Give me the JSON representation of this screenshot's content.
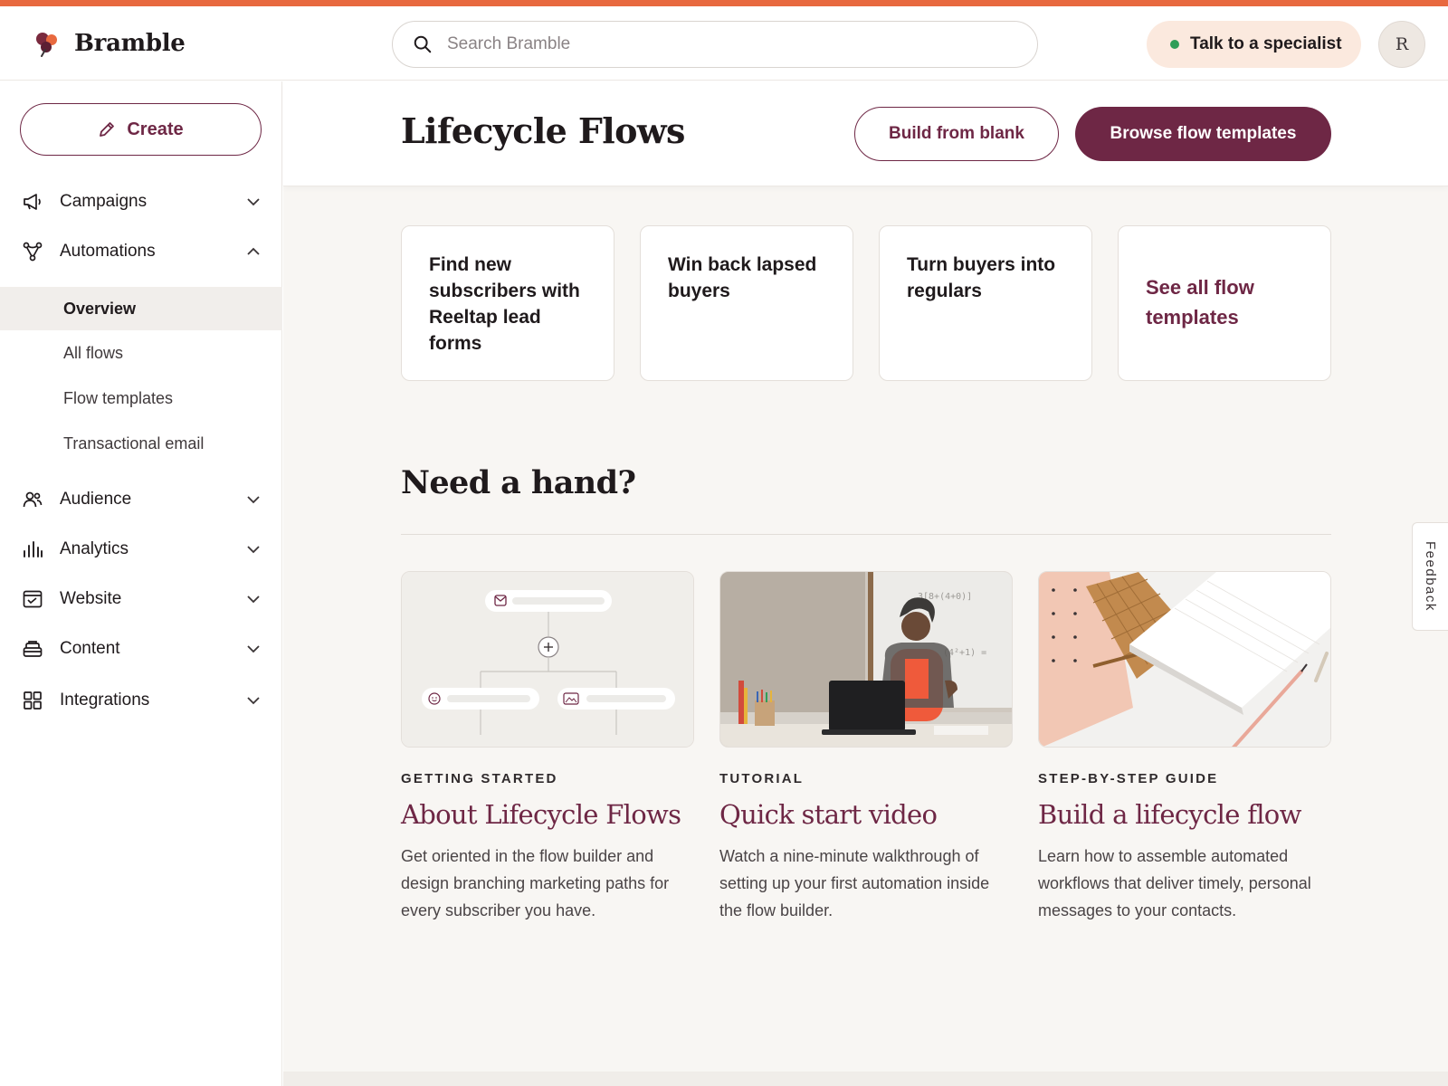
{
  "app": {
    "name": "Bramble"
  },
  "header": {
    "search_placeholder": "Search Bramble",
    "specialist_label": "Talk to a specialist",
    "avatar_initial": "R"
  },
  "sidebar": {
    "create_label": "Create",
    "items": [
      {
        "label": "Campaigns",
        "icon": "megaphone-icon",
        "expanded": false
      },
      {
        "label": "Automations",
        "icon": "automation-icon",
        "expanded": true
      },
      {
        "label": "Audience",
        "icon": "people-icon",
        "expanded": false
      },
      {
        "label": "Analytics",
        "icon": "bar-chart-icon",
        "expanded": false
      },
      {
        "label": "Website",
        "icon": "browser-icon",
        "expanded": false
      },
      {
        "label": "Content",
        "icon": "stack-icon",
        "expanded": false
      },
      {
        "label": "Integrations",
        "icon": "grid-icon",
        "expanded": false
      }
    ],
    "subitems": [
      {
        "label": "Overview",
        "active": true
      },
      {
        "label": "All flows",
        "active": false
      },
      {
        "label": "Flow templates",
        "active": false
      },
      {
        "label": "Transactional email",
        "active": false
      }
    ]
  },
  "page": {
    "title": "Lifecycle Flows",
    "build_blank_label": "Build from blank",
    "browse_templates_label": "Browse flow templates"
  },
  "tiles": [
    "Find new subscribers with Reeltap lead forms",
    "Win back lapsed buyers",
    "Turn buyers into regulars",
    "See all flow templates"
  ],
  "help": {
    "title": "Need a hand?",
    "cards": [
      {
        "eyebrow": "GETTING STARTED",
        "title": "About Lifecycle Flows",
        "desc": "Get oriented in the flow builder and design branching marketing paths for every subscriber you have."
      },
      {
        "eyebrow": "TUTORIAL",
        "title": "Quick start video",
        "desc": "Watch a nine-minute walkthrough of setting up your first automation inside the flow builder."
      },
      {
        "eyebrow": "STEP-BY-STEP GUIDE",
        "title": "Build a lifecycle flow",
        "desc": "Learn how to assemble automated workflows that deliver timely, personal messages to your contacts."
      }
    ]
  },
  "feedback_label": "Feedback",
  "colors": {
    "accent_bar": "#e8693f",
    "brand": "#6e2745",
    "specialist_bg": "#fbe9de",
    "status_online": "#2f9e58"
  }
}
